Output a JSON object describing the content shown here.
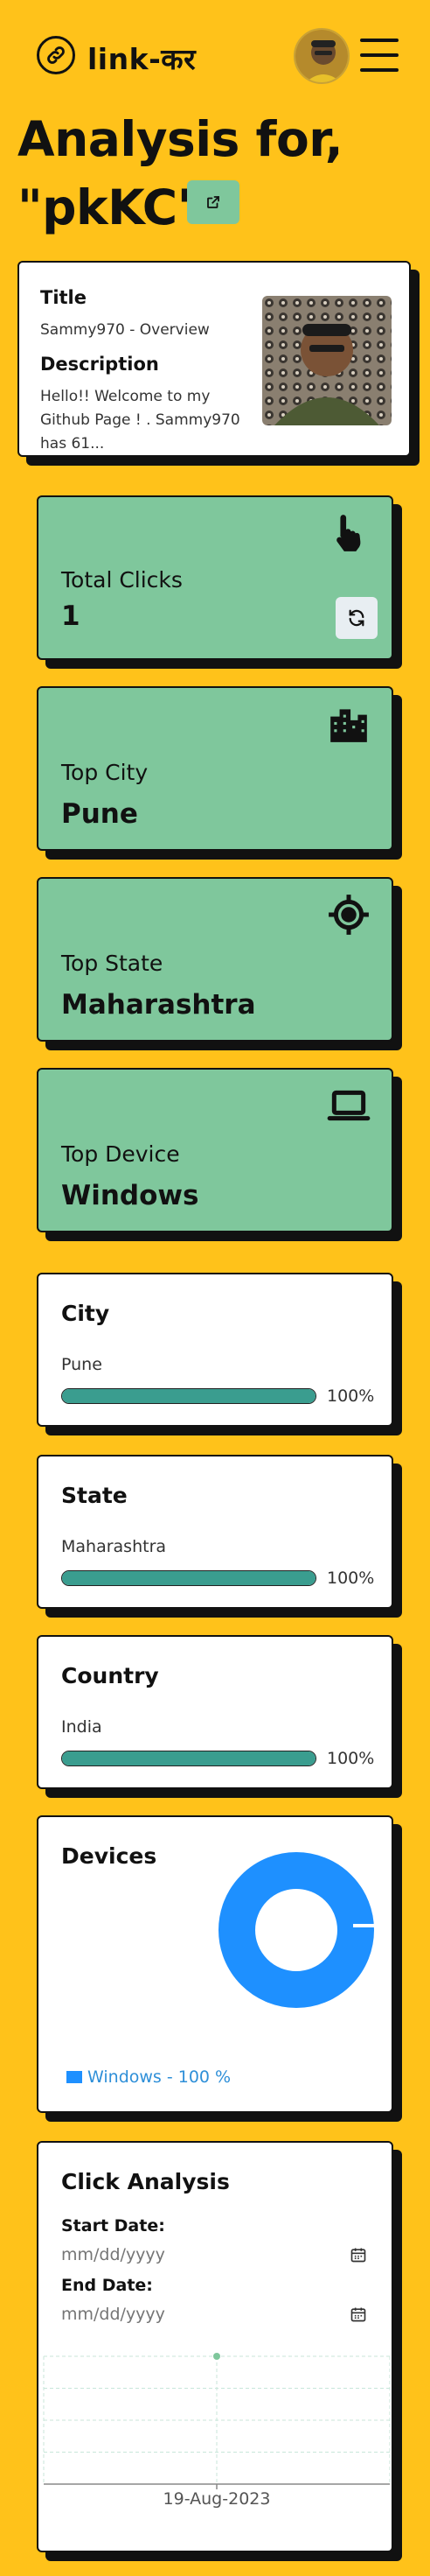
{
  "nav": {
    "logo_text": "link-कर",
    "icons": {
      "logo": "link-icon",
      "menu": "hamburger-menu-icon"
    }
  },
  "page": {
    "heading_line1": "Analysis for,",
    "heading_line2": "\"pkKC\""
  },
  "info": {
    "title_label": "Title",
    "title_value": "Sammy970 - Overview",
    "description_label": "Description",
    "description_value": "Hello!! Welcome to my Github Page ! . Sammy970 has 61..."
  },
  "stats": [
    {
      "label": "Total Clicks",
      "value": "1",
      "icon": "pointer-hand-icon"
    },
    {
      "label": "Top City",
      "value": "Pune",
      "icon": "city-buildings-icon"
    },
    {
      "label": "Top State",
      "value": "Maharashtra",
      "icon": "crosshair-location-icon"
    },
    {
      "label": "Top Device",
      "value": "Windows",
      "icon": "laptop-icon"
    }
  ],
  "breakdowns": [
    {
      "title": "City",
      "item": "Pune",
      "percent": 100,
      "percent_label": "100%"
    },
    {
      "title": "State",
      "item": "Maharashtra",
      "percent": 100,
      "percent_label": "100%"
    },
    {
      "title": "Country",
      "item": "India",
      "percent": 100,
      "percent_label": "100%"
    }
  ],
  "devices": {
    "title": "Devices",
    "legend": "Windows - 100 %",
    "color": "#1E90FF",
    "share": [
      {
        "name": "Windows",
        "percent": 100
      }
    ]
  },
  "click_analysis": {
    "title": "Click Analysis",
    "start_label": "Start Date:",
    "start_placeholder": "mm/dd/yyyy",
    "end_label": "End Date:",
    "end_placeholder": "mm/dd/yyyy"
  },
  "chart_data": {
    "type": "line",
    "x": [
      "19-Aug-2023"
    ],
    "series": [
      {
        "values": [
          1
        ]
      }
    ],
    "grid": true
  },
  "colors": {
    "background": "#FFC21A",
    "card_green": "#7FC79C",
    "bar_fill": "#3A9D8F",
    "donut": "#1E90FF"
  }
}
